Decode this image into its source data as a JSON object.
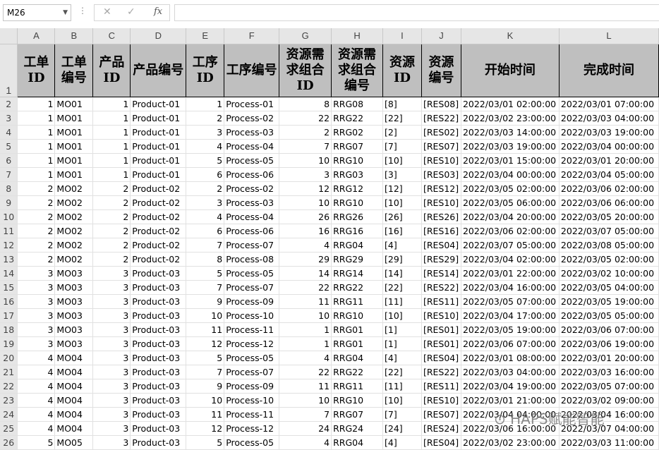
{
  "formula_bar": {
    "name_box": "M26",
    "cancel_icon": "✕",
    "enter_icon": "✓",
    "fx_label": "fx",
    "formula": ""
  },
  "columns": [
    "A",
    "B",
    "C",
    "D",
    "E",
    "F",
    "G",
    "H",
    "I",
    "J",
    "K",
    "L"
  ],
  "header_row": {
    "number": "1",
    "cells": [
      "工单ID",
      "工单编号",
      "产品ID",
      "产品编号",
      "工序ID",
      "工序编号",
      "资源需求组合ID",
      "资源需求组合编号",
      "资源ID",
      "资源编号",
      "开始时间",
      "完成时间"
    ]
  },
  "rows": [
    {
      "n": "2",
      "c": [
        "1",
        "MO01",
        "1",
        "Product-01",
        "1",
        "Process-01",
        "8",
        "RRG08",
        "[8]",
        "[RES08]",
        "2022/03/01 02:00:00",
        "2022/03/01 07:00:00"
      ]
    },
    {
      "n": "3",
      "c": [
        "1",
        "MO01",
        "1",
        "Product-01",
        "2",
        "Process-02",
        "22",
        "RRG22",
        "[22]",
        "[RES22]",
        "2022/03/02 23:00:00",
        "2022/03/03 04:00:00"
      ]
    },
    {
      "n": "4",
      "c": [
        "1",
        "MO01",
        "1",
        "Product-01",
        "3",
        "Process-03",
        "2",
        "RRG02",
        "[2]",
        "[RES02]",
        "2022/03/03 14:00:00",
        "2022/03/03 19:00:00"
      ]
    },
    {
      "n": "5",
      "c": [
        "1",
        "MO01",
        "1",
        "Product-01",
        "4",
        "Process-04",
        "7",
        "RRG07",
        "[7]",
        "[RES07]",
        "2022/03/03 19:00:00",
        "2022/03/04 00:00:00"
      ]
    },
    {
      "n": "6",
      "c": [
        "1",
        "MO01",
        "1",
        "Product-01",
        "5",
        "Process-05",
        "10",
        "RRG10",
        "[10]",
        "[RES10]",
        "2022/03/01 15:00:00",
        "2022/03/01 20:00:00"
      ]
    },
    {
      "n": "7",
      "c": [
        "1",
        "MO01",
        "1",
        "Product-01",
        "6",
        "Process-06",
        "3",
        "RRG03",
        "[3]",
        "[RES03]",
        "2022/03/04 00:00:00",
        "2022/03/04 05:00:00"
      ]
    },
    {
      "n": "8",
      "c": [
        "2",
        "MO02",
        "2",
        "Product-02",
        "2",
        "Process-02",
        "12",
        "RRG12",
        "[12]",
        "[RES12]",
        "2022/03/05 02:00:00",
        "2022/03/06 02:00:00"
      ]
    },
    {
      "n": "9",
      "c": [
        "2",
        "MO02",
        "2",
        "Product-02",
        "3",
        "Process-03",
        "10",
        "RRG10",
        "[10]",
        "[RES10]",
        "2022/03/05 06:00:00",
        "2022/03/06 06:00:00"
      ]
    },
    {
      "n": "10",
      "c": [
        "2",
        "MO02",
        "2",
        "Product-02",
        "4",
        "Process-04",
        "26",
        "RRG26",
        "[26]",
        "[RES26]",
        "2022/03/04 20:00:00",
        "2022/03/05 20:00:00"
      ]
    },
    {
      "n": "11",
      "c": [
        "2",
        "MO02",
        "2",
        "Product-02",
        "6",
        "Process-06",
        "16",
        "RRG16",
        "[16]",
        "[RES16]",
        "2022/03/06 02:00:00",
        "2022/03/07 05:00:00"
      ]
    },
    {
      "n": "12",
      "c": [
        "2",
        "MO02",
        "2",
        "Product-02",
        "7",
        "Process-07",
        "4",
        "RRG04",
        "[4]",
        "[RES04]",
        "2022/03/07 05:00:00",
        "2022/03/08 05:00:00"
      ]
    },
    {
      "n": "13",
      "c": [
        "2",
        "MO02",
        "2",
        "Product-02",
        "8",
        "Process-08",
        "29",
        "RRG29",
        "[29]",
        "[RES29]",
        "2022/03/04 02:00:00",
        "2022/03/05 02:00:00"
      ]
    },
    {
      "n": "14",
      "c": [
        "3",
        "MO03",
        "3",
        "Product-03",
        "5",
        "Process-05",
        "14",
        "RRG14",
        "[14]",
        "[RES14]",
        "2022/03/01 22:00:00",
        "2022/03/02 10:00:00"
      ]
    },
    {
      "n": "15",
      "c": [
        "3",
        "MO03",
        "3",
        "Product-03",
        "7",
        "Process-07",
        "22",
        "RRG22",
        "[22]",
        "[RES22]",
        "2022/03/04 16:00:00",
        "2022/03/05 04:00:00"
      ]
    },
    {
      "n": "16",
      "c": [
        "3",
        "MO03",
        "3",
        "Product-03",
        "9",
        "Process-09",
        "11",
        "RRG11",
        "[11]",
        "[RES11]",
        "2022/03/05 07:00:00",
        "2022/03/05 19:00:00"
      ]
    },
    {
      "n": "17",
      "c": [
        "3",
        "MO03",
        "3",
        "Product-03",
        "10",
        "Process-10",
        "10",
        "RRG10",
        "[10]",
        "[RES10]",
        "2022/03/04 17:00:00",
        "2022/03/05 05:00:00"
      ]
    },
    {
      "n": "18",
      "c": [
        "3",
        "MO03",
        "3",
        "Product-03",
        "11",
        "Process-11",
        "1",
        "RRG01",
        "[1]",
        "[RES01]",
        "2022/03/05 19:00:00",
        "2022/03/06 07:00:00"
      ]
    },
    {
      "n": "19",
      "c": [
        "3",
        "MO03",
        "3",
        "Product-03",
        "12",
        "Process-12",
        "1",
        "RRG01",
        "[1]",
        "[RES01]",
        "2022/03/06 07:00:00",
        "2022/03/06 19:00:00"
      ]
    },
    {
      "n": "20",
      "c": [
        "4",
        "MO04",
        "3",
        "Product-03",
        "5",
        "Process-05",
        "4",
        "RRG04",
        "[4]",
        "[RES04]",
        "2022/03/01 08:00:00",
        "2022/03/01 20:00:00"
      ]
    },
    {
      "n": "21",
      "c": [
        "4",
        "MO04",
        "3",
        "Product-03",
        "7",
        "Process-07",
        "22",
        "RRG22",
        "[22]",
        "[RES22]",
        "2022/03/03 04:00:00",
        "2022/03/03 16:00:00"
      ]
    },
    {
      "n": "22",
      "c": [
        "4",
        "MO04",
        "3",
        "Product-03",
        "9",
        "Process-09",
        "11",
        "RRG11",
        "[11]",
        "[RES11]",
        "2022/03/04 19:00:00",
        "2022/03/05 07:00:00"
      ]
    },
    {
      "n": "23",
      "c": [
        "4",
        "MO04",
        "3",
        "Product-03",
        "10",
        "Process-10",
        "10",
        "RRG10",
        "[10]",
        "[RES10]",
        "2022/03/01 21:00:00",
        "2022/03/02 09:00:00"
      ]
    },
    {
      "n": "24",
      "c": [
        "4",
        "MO04",
        "3",
        "Product-03",
        "11",
        "Process-11",
        "7",
        "RRG07",
        "[7]",
        "[RES07]",
        "2022/03/04 04:00:00",
        "2022/03/04 16:00:00"
      ]
    },
    {
      "n": "25",
      "c": [
        "4",
        "MO04",
        "3",
        "Product-03",
        "12",
        "Process-12",
        "24",
        "RRG24",
        "[24]",
        "[RES24]",
        "2022/03/06 16:00:00",
        "2022/03/07 04:00:00"
      ]
    },
    {
      "n": "26",
      "c": [
        "5",
        "MO05",
        "3",
        "Product-03",
        "5",
        "Process-05",
        "4",
        "RRG04",
        "[4]",
        "[RES04]",
        "2022/03/02 23:00:00",
        "2022/03/03 11:00:00"
      ]
    }
  ],
  "watermark": "⊙ HAPS赋能智能"
}
